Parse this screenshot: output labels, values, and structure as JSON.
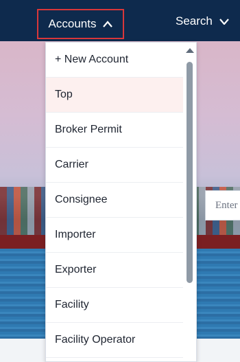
{
  "nav": {
    "accounts_label": "Accounts",
    "search_label": "Search",
    "accent_color": "#d9373a",
    "bar_color": "#0e2a4d"
  },
  "dropdown": {
    "items": [
      {
        "label": "+ New Account"
      },
      {
        "label": "Top"
      },
      {
        "label": "Broker Permit"
      },
      {
        "label": "Carrier"
      },
      {
        "label": "Consignee"
      },
      {
        "label": "Importer"
      },
      {
        "label": "Exporter"
      },
      {
        "label": "Facility"
      },
      {
        "label": "Facility Operator"
      }
    ],
    "highlighted_item": "Top"
  },
  "hero": {
    "input_placeholder": "Enter"
  },
  "icons": {
    "accounts": "chevron-up-icon",
    "search": "chevron-down-icon",
    "scroll": "scroll-up-arrow-icon"
  }
}
